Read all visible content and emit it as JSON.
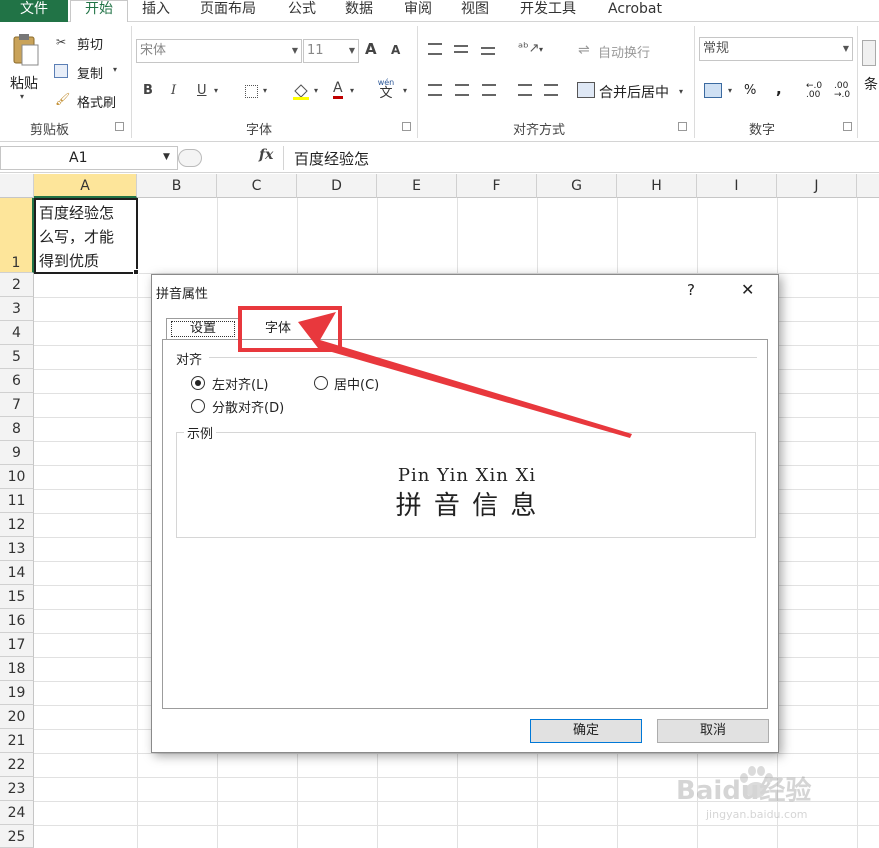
{
  "menubar": {
    "tabs": [
      "文件",
      "开始",
      "插入",
      "页面布局",
      "公式",
      "数据",
      "审阅",
      "视图",
      "开发工具",
      "Acrobat"
    ]
  },
  "ribbon": {
    "clipboard": {
      "paste": "粘贴",
      "cut": "剪切",
      "copy": "复制",
      "format_painter": "格式刷",
      "group_label": "剪贴板"
    },
    "font": {
      "font_name": "宋体",
      "font_size": "11",
      "group_label": "字体",
      "bold": "B",
      "italic": "I",
      "underline": "U",
      "grow": "A",
      "shrink": "A",
      "color_letter": "A",
      "phonetic_top": "wén",
      "phonetic_bottom": "文"
    },
    "alignment": {
      "wrap_text": "自动换行",
      "merge_center": "合并后居中",
      "group_label": "对齐方式"
    },
    "number": {
      "format": "常规",
      "percent": "%",
      "comma": ",",
      "inc_decimal": "←.0 .00",
      "dec_decimal": ".00 →.0",
      "group_label": "数字"
    },
    "styles": {
      "conditional": "条"
    }
  },
  "formula_bar": {
    "name_box": "A1",
    "fx": "fx",
    "content": "百度经验怎"
  },
  "grid": {
    "columns": [
      "A",
      "B",
      "C",
      "D",
      "E",
      "F",
      "G",
      "H",
      "I",
      "J"
    ],
    "rows": [
      "1",
      "2",
      "3",
      "4",
      "5",
      "6",
      "7",
      "8",
      "9",
      "10",
      "11",
      "12",
      "13",
      "14",
      "15",
      "16",
      "17",
      "18",
      "19",
      "20",
      "21",
      "22",
      "23",
      "24",
      "25"
    ],
    "cell_a1_lines": [
      "百度经验怎",
      "么写，才能",
      "得到优质"
    ]
  },
  "dialog": {
    "title": "拼音属性",
    "help": "?",
    "close": "✕",
    "tabs": [
      "设置",
      "字体"
    ],
    "align_label": "对齐",
    "options": [
      "左对齐(L)",
      "居中(C)",
      "分散对齐(D)"
    ],
    "selected_option": "左对齐(L)",
    "sample_label": "示例",
    "sample_pinyin": "Pin Yin Xin Xi",
    "sample_chars": "拼 音 信 息",
    "ok": "确定",
    "cancel": "取消"
  },
  "annotation": {
    "color": "#e8383d"
  },
  "watermark": {
    "text": "Baidu经验",
    "url": "jingyan.baidu.com"
  }
}
